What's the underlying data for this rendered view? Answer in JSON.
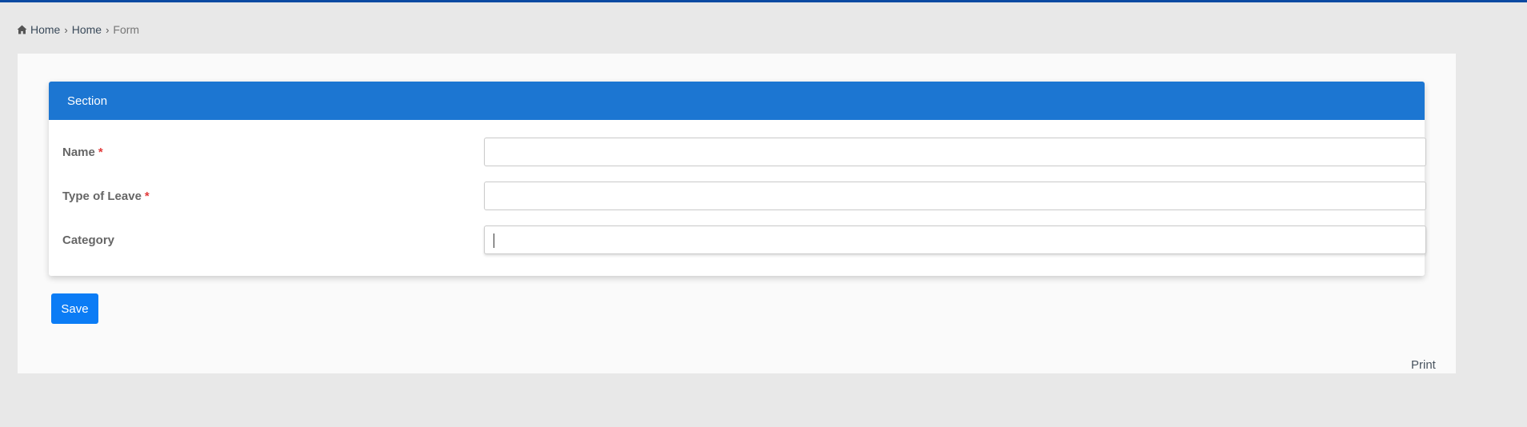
{
  "breadcrumb": {
    "items": [
      "Home",
      "Home",
      "Form"
    ],
    "separator": "›"
  },
  "section": {
    "title": "Section",
    "fields": [
      {
        "label": "Name",
        "required": "*",
        "value": ""
      },
      {
        "label": "Type of Leave",
        "required": "*",
        "value": ""
      },
      {
        "label": "Category",
        "required": "",
        "value": ""
      }
    ]
  },
  "actions": {
    "save_label": "Save",
    "print_label": "Print"
  },
  "colors": {
    "top_bar": "#0b4aa2",
    "section_header": "#1c76d2",
    "save_button": "#0b7cf5",
    "required": "#e23b3b"
  },
  "icons": {
    "breadcrumb_home": "home-icon"
  }
}
